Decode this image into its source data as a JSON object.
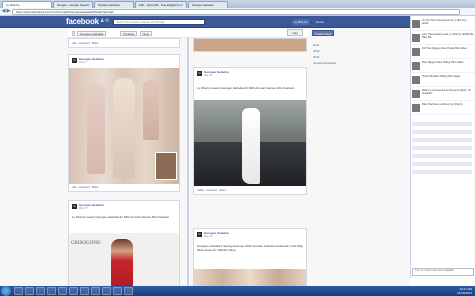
{
  "browser": {
    "tabs": [
      {
        "label": "Ly Nha Ky"
      },
      {
        "label": "Google - Google Search"
      },
      {
        "label": "Giorgio Hebeika"
      },
      {
        "label": "Zdu - nhau FB - Kuo.ka@lych.vn"
      },
      {
        "label": "Giorgio Hebeika"
      }
    ],
    "url": "https://www.facebook.com/?ref=home#!/GeorgesHebeikaOfficial/?sk=wall",
    "back": "◀",
    "fwd": "▶"
  },
  "fb": {
    "logo": "facebook",
    "search_placeholder": "Search for people, places and things",
    "user": "Ly Nha Ky",
    "home": "Home",
    "icons": [
      "friends-icon",
      "messages-icon",
      "notifications-icon"
    ]
  },
  "page": {
    "name": "Georges Hebeika",
    "timeline": "Timeline",
    "now": "Now",
    "like": "Like",
    "create_page": "Create Page",
    "side_links": [
      "Now",
      "2012",
      "2011",
      "Joined Facebook"
    ]
  },
  "posts": {
    "top_left_actions": "Like · Comment · Share",
    "p1": {
      "name": "Georges Hebeika",
      "date": "June 1 · ",
      "actions": "Like · Comment · Share"
    },
    "p2": {
      "name": "Georges Hebeika",
      "date": "May 21 · ",
      "text": "Ly Nha Ky wears Georges Hebeika for 66th Annual Cannes Film Festival",
      "actions": "Unlike · Comment · Share"
    },
    "p3": {
      "name": "Georges Hebeika",
      "date": "May 17 · ",
      "text": "Ly Nha Ky wears Georges Hebeika for 66th Annual Cannes Film Festival",
      "brand": "GRISOGONO"
    },
    "p4": {
      "name": "Georges Hebeika",
      "date": "May 14 · ",
      "text": "Georges Hebeika's Spring-Summer 2011 Couture collection featured in the May 2011 issue of L'Officiel China."
    }
  },
  "ticker": [
    {
      "text": "Vu Tien Son commented on Ly Nha Ky's photo."
    },
    {
      "text": "Lam Thao shared a link. Ly Nha Ky via Ban Be Hiện đại."
    },
    {
      "text": "Chi Tran Nguyen likes Hoàng Hà's video."
    },
    {
      "text": "Hieu Nguyen likes Hoàng Hà's status."
    },
    {
      "text": "Thanh Nhi likes Hoàng Hà's status."
    },
    {
      "text": "Nhan Le commented on Ha Lan's photo: \"so beautiful\"."
    },
    {
      "text": "Diệu Tran likes a photo of Ly Nha Ky."
    }
  ],
  "chat_box": "Turn on chat to see who's available.",
  "taskbar": {
    "time": "10:17 AM",
    "date": "12/19/2012"
  }
}
